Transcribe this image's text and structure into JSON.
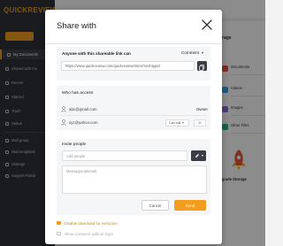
{
  "app": {
    "logo_text": "QUICKREVIEW",
    "new_button_label": "",
    "sidebar_items": [
      {
        "label": "My Documents",
        "active": true
      },
      {
        "label": "Shared with me"
      },
      {
        "label": "Recent"
      },
      {
        "label": "Starred"
      },
      {
        "label": "Trash"
      },
      {
        "label": "Status"
      },
      {
        "label": "Mail group"
      },
      {
        "label": "Mail templates"
      },
      {
        "label": "Settings"
      },
      {
        "label": "Support Portal"
      }
    ],
    "storage_title": "rage",
    "storage_items": [
      {
        "name": "Documents",
        "size": "",
        "color": "#e7543b"
      },
      {
        "name": "Videos",
        "size": "",
        "color": "#3aa3e3"
      },
      {
        "name": "Images",
        "size": "",
        "color": "#8e6cd9"
      },
      {
        "name": "Other Files",
        "size": "",
        "color": "#2bb673"
      }
    ],
    "upgrade_label": "pgrade Storage"
  },
  "modal": {
    "title": "Share with",
    "link": {
      "label": "Anyone with this shareable link can",
      "permission": "Comment",
      "url": "https://www.quickreview.com/quickreview/docs/mnshipptd"
    },
    "access": {
      "title": "Who has access",
      "people": [
        {
          "email": "abc@gmail.com",
          "role": "Owner"
        },
        {
          "email": "xyz@yahoo.com",
          "role": "Can edit"
        }
      ]
    },
    "invite": {
      "title": "Invite people",
      "add_placeholder": "Add people",
      "message_placeholder": "Message(optional)",
      "cancel_label": "Cancel",
      "send_label": "Send"
    },
    "options": [
      {
        "label": "Disable download for everyone",
        "checked": true
      },
      {
        "label": "Allow comment without login",
        "checked": false
      }
    ]
  },
  "colors": {
    "accent": "#f29d1f",
    "sidebar": "#2f3238",
    "dark_button": "#3a3d45"
  }
}
